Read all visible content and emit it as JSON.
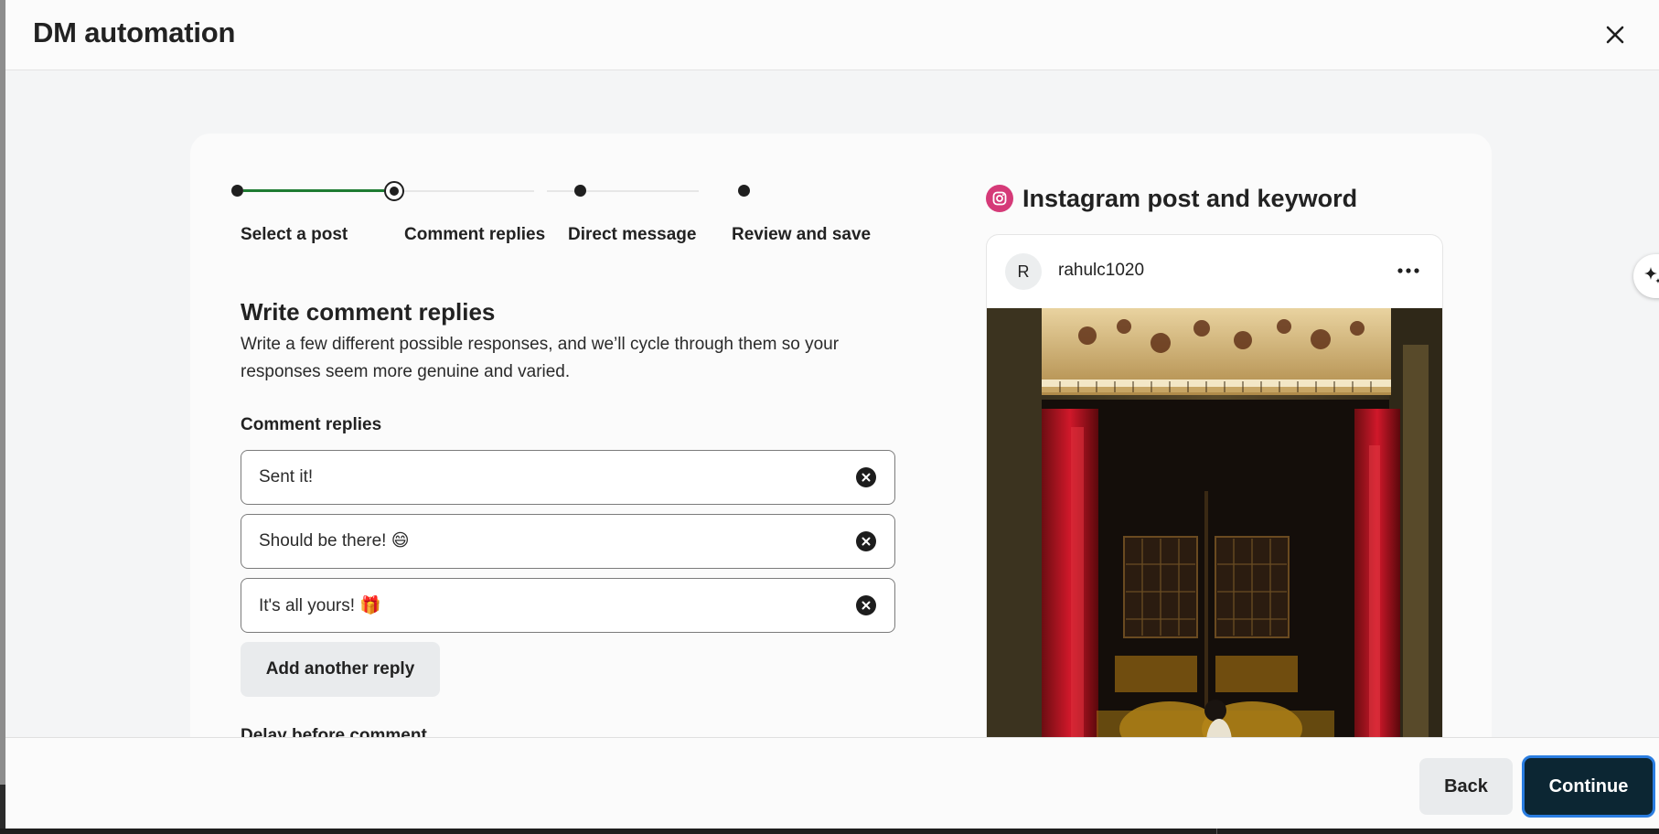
{
  "header": {
    "title": "DM automation"
  },
  "stepper": {
    "steps": [
      {
        "label": "Select a post",
        "state": "complete"
      },
      {
        "label": "Comment replies",
        "state": "current"
      },
      {
        "label": "Direct message",
        "state": "upcoming"
      },
      {
        "label": "Review and save",
        "state": "upcoming"
      }
    ]
  },
  "form": {
    "title": "Write comment replies",
    "description": "Write a few different possible responses, and we’ll cycle through them so your responses seem more genuine and varied.",
    "replies_label": "Comment replies",
    "replies": [
      {
        "value": "Sent it!"
      },
      {
        "value": "Should be there! 😄"
      },
      {
        "value": "It's all yours! 🎁"
      }
    ],
    "add_reply_label": "Add another reply",
    "delay_label": "Delay before comment"
  },
  "preview": {
    "title": "Instagram post and keyword",
    "avatar_initial": "R",
    "username": "rahulc1020"
  },
  "footer": {
    "back_label": "Back",
    "continue_label": "Continue"
  },
  "icons": {
    "close": "close-icon",
    "clear": "clear-circle-icon",
    "instagram": "instagram-icon",
    "more": "more-horizontal-icon",
    "sparkle": "sparkle-icon"
  },
  "colors": {
    "progress": "#1e7b32",
    "instagram": "#d53a78",
    "primary_button": "#0c2633",
    "focus_ring": "#2a7de1"
  }
}
